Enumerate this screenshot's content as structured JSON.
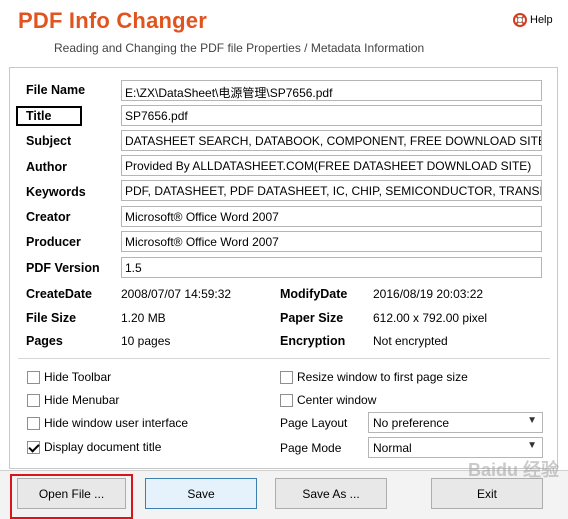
{
  "app": {
    "title": "PDF Info Changer",
    "subtitle": "Reading and Changing the PDF file Properties / Metadata Information",
    "help_label": "Help"
  },
  "fields": {
    "file_name": {
      "label": "File Name",
      "value": "E:\\ZX\\DataSheet\\电源管理\\SP7656.pdf"
    },
    "title": {
      "label": "Title",
      "value": "SP7656.pdf"
    },
    "subject": {
      "label": "Subject",
      "value": "DATASHEET SEARCH, DATABOOK, COMPONENT, FREE DOWNLOAD SITE"
    },
    "author": {
      "label": "Author",
      "value": "Provided By ALLDATASHEET.COM(FREE DATASHEET DOWNLOAD SITE)"
    },
    "keywords": {
      "label": "Keywords",
      "value": "PDF, DATASHEET, PDF DATASHEET, IC, CHIP, SEMICONDUCTOR, TRANSIS"
    },
    "creator": {
      "label": "Creator",
      "value": "Microsoft® Office Word 2007"
    },
    "producer": {
      "label": "Producer",
      "value": "Microsoft® Office Word 2007"
    },
    "pdf_version": {
      "label": "PDF Version",
      "value": "1.5"
    }
  },
  "info": {
    "create_date": {
      "label": "CreateDate",
      "value": "2008/07/07 14:59:32"
    },
    "modify_date": {
      "label": "ModifyDate",
      "value": "2016/08/19 20:03:22"
    },
    "file_size": {
      "label": "File Size",
      "value": "1.20 MB"
    },
    "paper_size": {
      "label": "Paper Size",
      "value": "612.00 x 792.00 pixel"
    },
    "pages": {
      "label": "Pages",
      "value": "10 pages"
    },
    "encryption": {
      "label": "Encryption",
      "value": "Not encrypted"
    }
  },
  "options": {
    "hide_toolbar": {
      "label": "Hide Toolbar",
      "checked": false
    },
    "hide_menubar": {
      "label": "Hide Menubar",
      "checked": false
    },
    "hide_window_ui": {
      "label": "Hide window user interface",
      "checked": false
    },
    "display_doc_title": {
      "label": "Display document title",
      "checked": true
    },
    "resize_window": {
      "label": "Resize window to first page size",
      "checked": false
    },
    "center_window": {
      "label": "Center window",
      "checked": false
    },
    "page_layout": {
      "label": "Page Layout",
      "value": "No preference"
    },
    "page_mode": {
      "label": "Page Mode",
      "value": "Normal"
    }
  },
  "buttons": {
    "open_file": "Open File ...",
    "save": "Save",
    "save_as": "Save As ...",
    "exit": "Exit"
  },
  "watermark": "Baidu 经验",
  "colors": {
    "title": "#e2541f",
    "highlight_box": "#d8141c",
    "save_button_border": "#3c7fb1"
  }
}
